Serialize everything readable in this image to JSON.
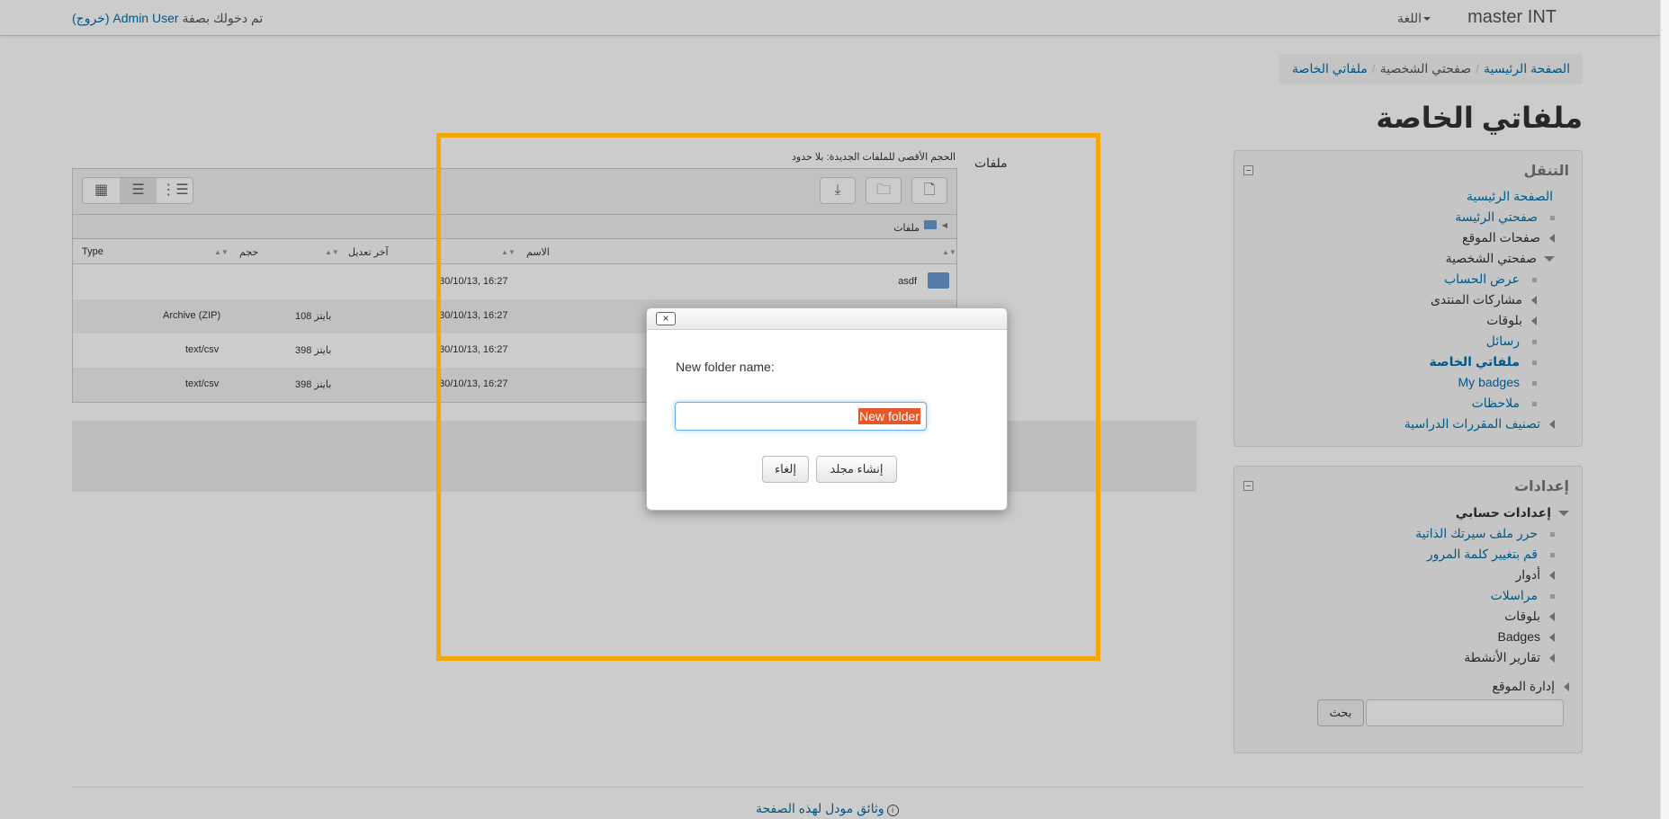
{
  "navbar": {
    "brand": "master INT",
    "language": "اللغة",
    "login_prefix": "تم دخولك بصفة",
    "user": "Admin User",
    "logout": "(خروج)"
  },
  "breadcrumb": {
    "items": [
      "الصفحة الرئيسية",
      "صفحتي الشخصية",
      "ملفاتي الخاصة"
    ]
  },
  "page_title": "ملفاتي الخاصة",
  "navigation_block": {
    "title": "التنقل",
    "items": [
      "الصفحة الرئيسية",
      "صفحتي الرئيسة",
      "صفحات الموقع",
      "صفحتي الشخصية",
      "عرض الحساب",
      "مشاركات المنتدى",
      "بلوقات",
      "رسائل",
      "ملفاتي الخاصة",
      "My badges",
      "ملاحظات",
      "تصنيف المقررات الدراسية"
    ]
  },
  "settings_block": {
    "title": "إعدادات",
    "items": [
      "إعدادات حسابي",
      "حرر ملف سيرتك الذاتية",
      "قم بتغيير كلمة المرور",
      "أدوار",
      "مراسلات",
      "بلوقات",
      "Badges",
      "تقارير الأنشطة",
      "إدارة الموقع"
    ],
    "search_button": "بحث"
  },
  "filemanager": {
    "label": "ملفات",
    "max_size": "الحجم الأقصى للملفات الجديدة: بلا حدود",
    "path": "ملفات",
    "columns": [
      "الاسم",
      "آخر تعديل",
      "حجم",
      "Type"
    ],
    "rows": [
      {
        "name": "asdf",
        "modified": "30/10/13, 16:27",
        "size": "",
        "type": ""
      },
      {
        "name": "",
        "modified": "30/10/13, 16:27",
        "size": "108 بايتز",
        "type": "Archive (ZIP)"
      },
      {
        "name": "",
        "modified": "30/10/13, 16:27",
        "size": "398 بايتز",
        "type": "text/csv"
      },
      {
        "name": "",
        "modified": "30/10/13, 16:27",
        "size": "398 بايتز",
        "type": "text/csv"
      }
    ]
  },
  "dialog": {
    "close": "×",
    "label": "New folder name:",
    "input_value": "New folder",
    "create_button": "إنشاء مجلد",
    "cancel_button": "إلغاء"
  },
  "footer": {
    "docs_link": "وثائق مودل لهذه الصفحة"
  },
  "colors": {
    "link": "#0070a8",
    "highlight_border": "#f5a800",
    "selection": "#e6582a"
  }
}
